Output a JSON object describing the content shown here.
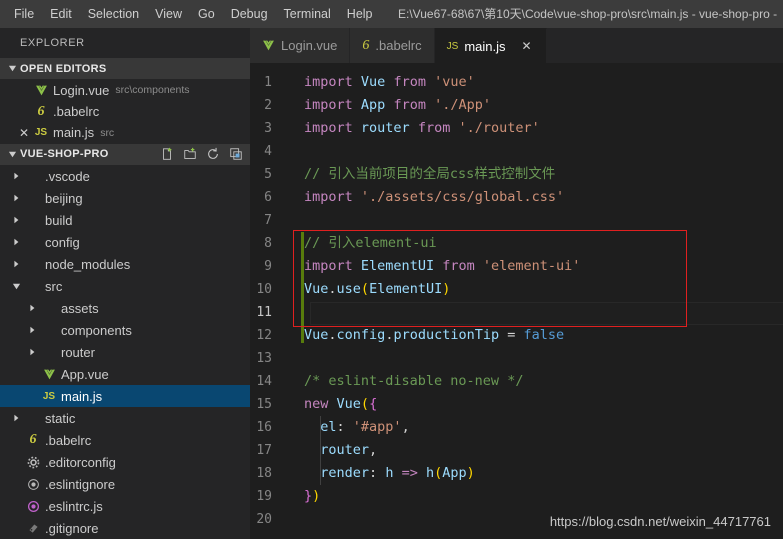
{
  "titlebar": {
    "menu": [
      "File",
      "Edit",
      "Selection",
      "View",
      "Go",
      "Debug",
      "Terminal",
      "Help"
    ],
    "window_title": "E:\\Vue67-68\\67\\第10天\\Code\\vue-shop-pro\\src\\main.js - vue-shop-pro -"
  },
  "sidebar": {
    "title": "EXPLORER",
    "open_editors": {
      "label": "OPEN EDITORS",
      "items": [
        {
          "name": "Login.vue",
          "desc": "src\\components",
          "icon": "vue-file-icon",
          "dirty": false,
          "selected": false
        },
        {
          "name": ".babelrc",
          "desc": "",
          "icon": "babel-file-icon",
          "dirty": false,
          "selected": false
        },
        {
          "name": "main.js",
          "desc": "src",
          "icon": "js-file-icon",
          "dirty": true,
          "selected": false
        }
      ]
    },
    "project": {
      "label": "VUE-SHOP-PRO",
      "actions": [
        "new-file-icon",
        "new-folder-icon",
        "refresh-icon",
        "collapse-all-icon"
      ],
      "tree": [
        {
          "label": ".vscode",
          "type": "folder",
          "expanded": false,
          "depth": 0,
          "icon": ""
        },
        {
          "label": "beijing",
          "type": "folder",
          "expanded": false,
          "depth": 0,
          "icon": ""
        },
        {
          "label": "build",
          "type": "folder",
          "expanded": false,
          "depth": 0,
          "icon": ""
        },
        {
          "label": "config",
          "type": "folder",
          "expanded": false,
          "depth": 0,
          "icon": ""
        },
        {
          "label": "node_modules",
          "type": "folder",
          "expanded": false,
          "depth": 0,
          "icon": ""
        },
        {
          "label": "src",
          "type": "folder",
          "expanded": true,
          "depth": 0,
          "icon": ""
        },
        {
          "label": "assets",
          "type": "folder",
          "expanded": false,
          "depth": 1,
          "icon": ""
        },
        {
          "label": "components",
          "type": "folder",
          "expanded": false,
          "depth": 1,
          "icon": ""
        },
        {
          "label": "router",
          "type": "folder",
          "expanded": false,
          "depth": 1,
          "icon": ""
        },
        {
          "label": "App.vue",
          "type": "file",
          "expanded": false,
          "depth": 1,
          "icon": "vue-file-icon"
        },
        {
          "label": "main.js",
          "type": "file",
          "expanded": false,
          "depth": 1,
          "icon": "js-file-icon",
          "selected": true
        },
        {
          "label": "static",
          "type": "folder",
          "expanded": false,
          "depth": 0,
          "icon": ""
        },
        {
          "label": ".babelrc",
          "type": "file",
          "expanded": false,
          "depth": 0,
          "icon": "babel-file-icon"
        },
        {
          "label": ".editorconfig",
          "type": "file",
          "expanded": false,
          "depth": 0,
          "icon": "gear-icon"
        },
        {
          "label": ".eslintignore",
          "type": "file",
          "expanded": false,
          "depth": 0,
          "icon": "circle-icon"
        },
        {
          "label": ".eslintrc.js",
          "type": "file",
          "expanded": false,
          "depth": 0,
          "icon": "eslint-icon"
        },
        {
          "label": ".gitignore",
          "type": "file",
          "expanded": false,
          "depth": 0,
          "icon": "git-icon"
        }
      ]
    }
  },
  "editor": {
    "tabs": [
      {
        "label": "Login.vue",
        "icon": "vue-file-icon",
        "active": false,
        "closable": false
      },
      {
        "label": ".babelrc",
        "icon": "babel-file-icon",
        "active": false,
        "closable": false
      },
      {
        "label": "main.js",
        "icon": "js-file-icon",
        "active": true,
        "closable": true,
        "close_glyph": "✕"
      }
    ],
    "code_lines": [
      {
        "n": "1",
        "tokens": [
          {
            "t": "import",
            "c": "key"
          },
          {
            "t": " ",
            "c": "plain"
          },
          {
            "t": "Vue",
            "c": "var"
          },
          {
            "t": " ",
            "c": "plain"
          },
          {
            "t": "from",
            "c": "key"
          },
          {
            "t": " ",
            "c": "plain"
          },
          {
            "t": "'vue'",
            "c": "str"
          }
        ]
      },
      {
        "n": "2",
        "tokens": [
          {
            "t": "import",
            "c": "key"
          },
          {
            "t": " ",
            "c": "plain"
          },
          {
            "t": "App",
            "c": "var"
          },
          {
            "t": " ",
            "c": "plain"
          },
          {
            "t": "from",
            "c": "key"
          },
          {
            "t": " ",
            "c": "plain"
          },
          {
            "t": "'./App'",
            "c": "str"
          }
        ]
      },
      {
        "n": "3",
        "tokens": [
          {
            "t": "import",
            "c": "key"
          },
          {
            "t": " ",
            "c": "plain"
          },
          {
            "t": "router",
            "c": "var"
          },
          {
            "t": " ",
            "c": "plain"
          },
          {
            "t": "from",
            "c": "key"
          },
          {
            "t": " ",
            "c": "plain"
          },
          {
            "t": "'./router'",
            "c": "str"
          }
        ]
      },
      {
        "n": "4",
        "tokens": []
      },
      {
        "n": "5",
        "tokens": [
          {
            "t": "// 引入当前项目的全局css样式控制文件",
            "c": "cmt"
          }
        ]
      },
      {
        "n": "6",
        "tokens": [
          {
            "t": "import",
            "c": "key"
          },
          {
            "t": " ",
            "c": "plain"
          },
          {
            "t": "'./assets/css/global.css'",
            "c": "str"
          }
        ]
      },
      {
        "n": "7",
        "tokens": []
      },
      {
        "n": "8",
        "tokens": [
          {
            "t": "// 引入element-ui",
            "c": "cmt"
          }
        ]
      },
      {
        "n": "9",
        "tokens": [
          {
            "t": "import",
            "c": "key"
          },
          {
            "t": " ",
            "c": "plain"
          },
          {
            "t": "ElementUI",
            "c": "var"
          },
          {
            "t": " ",
            "c": "plain"
          },
          {
            "t": "from",
            "c": "key"
          },
          {
            "t": " ",
            "c": "plain"
          },
          {
            "t": "'element-ui'",
            "c": "str"
          }
        ]
      },
      {
        "n": "10",
        "tokens": [
          {
            "t": "Vue",
            "c": "var"
          },
          {
            "t": ".",
            "c": "plain"
          },
          {
            "t": "use",
            "c": "var"
          },
          {
            "t": "(",
            "c": "paren1"
          },
          {
            "t": "ElementUI",
            "c": "var"
          },
          {
            "t": ")",
            "c": "paren1"
          }
        ]
      },
      {
        "n": "11",
        "tokens": [],
        "active": true
      },
      {
        "n": "12",
        "tokens": [
          {
            "t": "Vue",
            "c": "var"
          },
          {
            "t": ".",
            "c": "plain"
          },
          {
            "t": "config",
            "c": "var"
          },
          {
            "t": ".",
            "c": "plain"
          },
          {
            "t": "productionTip",
            "c": "var"
          },
          {
            "t": " = ",
            "c": "plain"
          },
          {
            "t": "false",
            "c": "blue"
          }
        ]
      },
      {
        "n": "13",
        "tokens": []
      },
      {
        "n": "14",
        "tokens": [
          {
            "t": "/* eslint-disable no-new */",
            "c": "cmt"
          }
        ]
      },
      {
        "n": "15",
        "tokens": [
          {
            "t": "new",
            "c": "key"
          },
          {
            "t": " ",
            "c": "plain"
          },
          {
            "t": "Vue",
            "c": "var"
          },
          {
            "t": "(",
            "c": "paren1"
          },
          {
            "t": "{",
            "c": "paren2"
          }
        ]
      },
      {
        "n": "16",
        "tokens": [
          {
            "t": "  ",
            "c": "plain"
          },
          {
            "t": "el",
            "c": "var"
          },
          {
            "t": ": ",
            "c": "plain"
          },
          {
            "t": "'#app'",
            "c": "str"
          },
          {
            "t": ",",
            "c": "plain"
          }
        ]
      },
      {
        "n": "17",
        "tokens": [
          {
            "t": "  ",
            "c": "plain"
          },
          {
            "t": "router",
            "c": "var"
          },
          {
            "t": ",",
            "c": "plain"
          }
        ]
      },
      {
        "n": "18",
        "tokens": [
          {
            "t": "  ",
            "c": "plain"
          },
          {
            "t": "render",
            "c": "var"
          },
          {
            "t": ": ",
            "c": "plain"
          },
          {
            "t": "h",
            "c": "var"
          },
          {
            "t": " ",
            "c": "plain"
          },
          {
            "t": "=>",
            "c": "key"
          },
          {
            "t": " ",
            "c": "plain"
          },
          {
            "t": "h",
            "c": "var"
          },
          {
            "t": "(",
            "c": "paren1"
          },
          {
            "t": "App",
            "c": "var"
          },
          {
            "t": ")",
            "c": "paren1"
          }
        ]
      },
      {
        "n": "19",
        "tokens": [
          {
            "t": "}",
            "c": "paren2"
          },
          {
            "t": ")",
            "c": "paren1"
          }
        ]
      },
      {
        "n": "20",
        "tokens": []
      }
    ],
    "annotation": {
      "shape": "rectangle",
      "color": "#e02020",
      "covers_lines": "8-11"
    }
  },
  "watermark": "https://blog.csdn.net/weixin_44717761",
  "colors": {
    "accent_selected": "#094771",
    "editor_bg": "#1e1e1e",
    "sidebar_bg": "#252526",
    "titlebar_bg": "#3c3c3c",
    "annotation_red": "#e02020",
    "git_added_green": "#587c0c"
  }
}
